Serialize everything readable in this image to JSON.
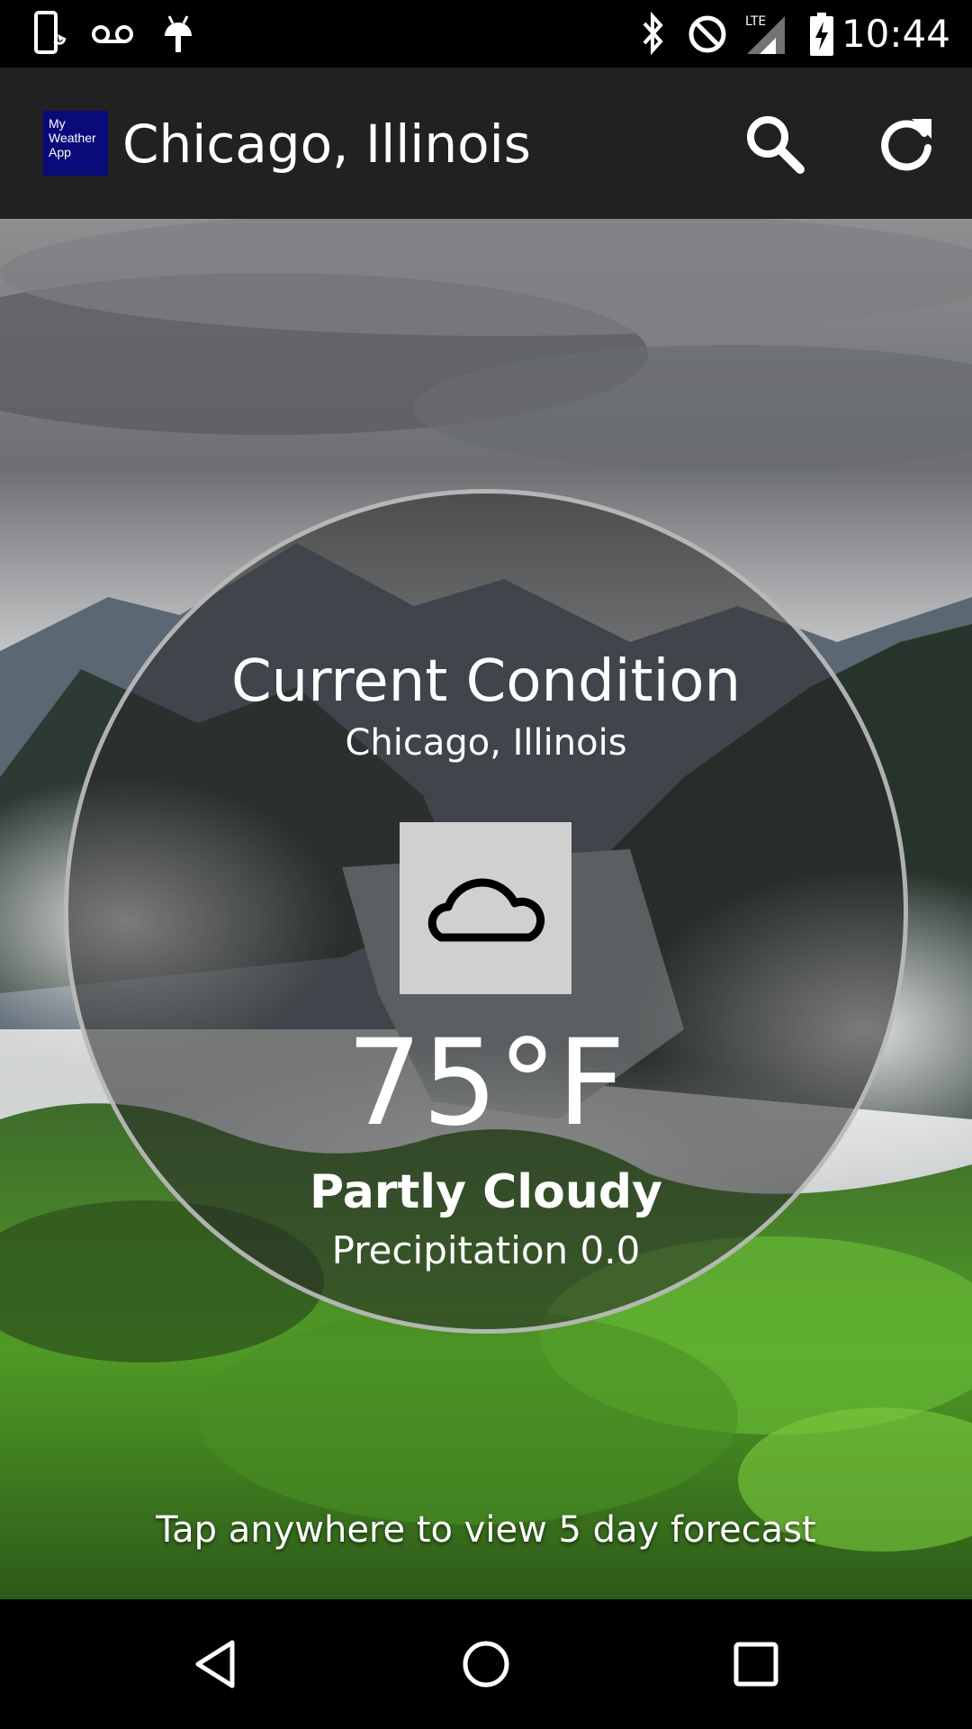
{
  "status_bar": {
    "time": "10:44",
    "icons": [
      "phone-icon",
      "voicemail-icon",
      "android-icon",
      "bluetooth-icon",
      "do-not-disturb-icon",
      "lte-signal-icon",
      "battery-charging-icon"
    ],
    "network_label": "LTE"
  },
  "app_bar": {
    "logo_text": "My Weather App",
    "title": "Chicago, Illinois",
    "actions": [
      "search-icon",
      "refresh-icon"
    ]
  },
  "condition": {
    "heading": "Current Condition",
    "location": "Chicago, Illinois",
    "icon": "cloud-icon",
    "temperature": "75°F",
    "summary": "Partly Cloudy",
    "precipitation": "Precipitation 0.0"
  },
  "hint": "Tap anywhere to view 5 day forecast",
  "nav_bar": {
    "buttons": [
      "back-icon",
      "home-icon",
      "recents-icon"
    ]
  },
  "colors": {
    "app_bar": "#212121",
    "logo_bg": "#0a0a7a",
    "status_bar": "#000000",
    "icon_box": "#d0d0d0"
  }
}
